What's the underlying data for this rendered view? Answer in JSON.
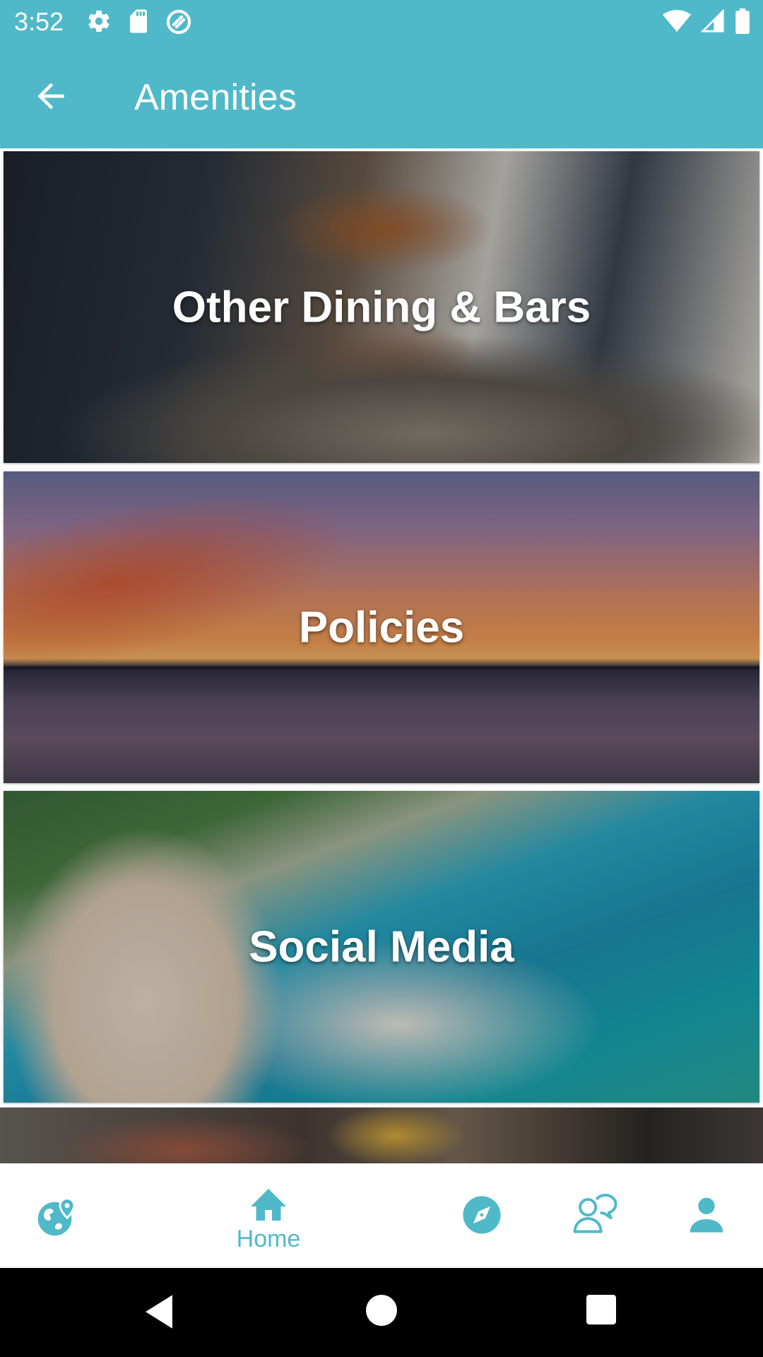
{
  "status_bar": {
    "time": "3:52",
    "left_icons": [
      "gear-icon",
      "sd-card-icon",
      "sync-circle-icon"
    ],
    "right_icons": [
      "wifi-icon",
      "signal-icon",
      "battery-icon"
    ]
  },
  "app_bar": {
    "title": "Amenities",
    "back_icon": "arrow-back-icon",
    "color": "#4fb9c9"
  },
  "cards": [
    {
      "label": "Other Dining & Bars"
    },
    {
      "label": "Policies"
    },
    {
      "label": "Social Media"
    },
    {
      "label": ""
    }
  ],
  "bottom_nav": {
    "accent": "#4fb9c9",
    "items": [
      {
        "icon": "globe-pin-icon",
        "label": ""
      },
      {
        "icon": "home-icon",
        "label": "Home"
      },
      {
        "icon": "compass-icon",
        "label": ""
      },
      {
        "icon": "chat-person-icon",
        "label": ""
      },
      {
        "icon": "person-icon",
        "label": ""
      }
    ]
  },
  "system_nav": {
    "icons": [
      "back-triangle-icon",
      "home-circle-icon",
      "recents-square-icon"
    ]
  }
}
